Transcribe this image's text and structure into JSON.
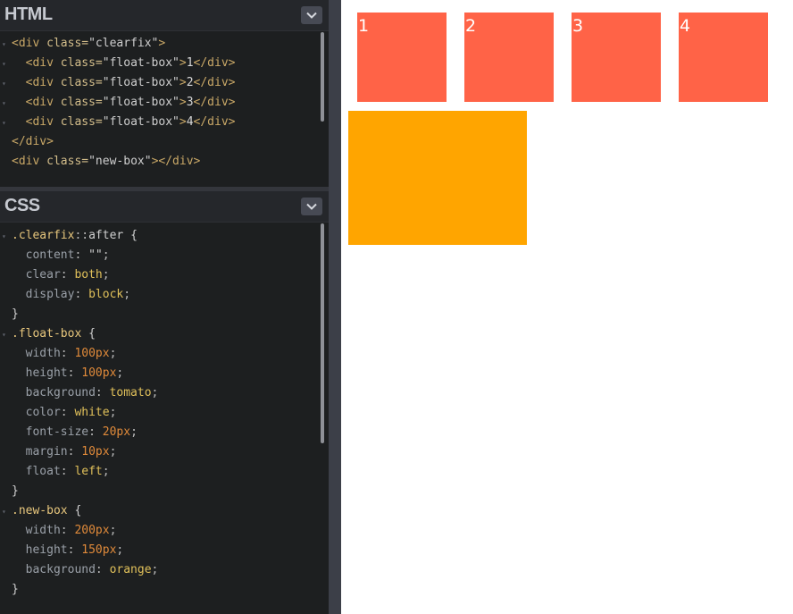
{
  "html_panel": {
    "title": "HTML",
    "lines": [
      {
        "fold": true,
        "parts": [
          [
            "tag",
            "<div "
          ],
          [
            "attr",
            "class="
          ],
          [
            "str",
            "\"clearfix\""
          ],
          [
            "tag",
            ">"
          ]
        ]
      },
      {
        "fold": true,
        "parts": [
          [
            "txt",
            "  "
          ],
          [
            "tag",
            "<div "
          ],
          [
            "attr",
            "class="
          ],
          [
            "str",
            "\"float-box\""
          ],
          [
            "tag",
            ">"
          ],
          [
            "txt",
            "1"
          ],
          [
            "tag",
            "</div>"
          ]
        ]
      },
      {
        "fold": true,
        "parts": [
          [
            "txt",
            "  "
          ],
          [
            "tag",
            "<div "
          ],
          [
            "attr",
            "class="
          ],
          [
            "str",
            "\"float-box\""
          ],
          [
            "tag",
            ">"
          ],
          [
            "txt",
            "2"
          ],
          [
            "tag",
            "</div>"
          ]
        ]
      },
      {
        "fold": true,
        "parts": [
          [
            "txt",
            "  "
          ],
          [
            "tag",
            "<div "
          ],
          [
            "attr",
            "class="
          ],
          [
            "str",
            "\"float-box\""
          ],
          [
            "tag",
            ">"
          ],
          [
            "txt",
            "3"
          ],
          [
            "tag",
            "</div>"
          ]
        ]
      },
      {
        "fold": true,
        "parts": [
          [
            "txt",
            "  "
          ],
          [
            "tag",
            "<div "
          ],
          [
            "attr",
            "class="
          ],
          [
            "str",
            "\"float-box\""
          ],
          [
            "tag",
            ">"
          ],
          [
            "txt",
            "4"
          ],
          [
            "tag",
            "</div>"
          ]
        ]
      },
      {
        "fold": false,
        "parts": [
          [
            "tag",
            "</div>"
          ]
        ]
      },
      {
        "fold": false,
        "parts": [
          [
            "tag",
            "<div "
          ],
          [
            "attr",
            "class="
          ],
          [
            "str",
            "\"new-box\""
          ],
          [
            "tag",
            "></div>"
          ]
        ]
      }
    ]
  },
  "css_panel": {
    "title": "CSS",
    "lines": [
      {
        "fold": true,
        "parts": [
          [
            "sel",
            ".clearfix"
          ],
          [
            "punct",
            "::"
          ],
          [
            "brace",
            "after {"
          ]
        ]
      },
      {
        "fold": false,
        "parts": [
          [
            "prop",
            "  content"
          ],
          [
            "punct",
            ": "
          ],
          [
            "str",
            "\"\""
          ],
          [
            "punct",
            ";"
          ]
        ]
      },
      {
        "fold": false,
        "parts": [
          [
            "prop",
            "  clear"
          ],
          [
            "punct",
            ": "
          ],
          [
            "val",
            "both"
          ],
          [
            "punct",
            ";"
          ]
        ]
      },
      {
        "fold": false,
        "parts": [
          [
            "prop",
            "  display"
          ],
          [
            "punct",
            ": "
          ],
          [
            "val",
            "block"
          ],
          [
            "punct",
            ";"
          ]
        ]
      },
      {
        "fold": false,
        "parts": [
          [
            "brace",
            "}"
          ]
        ]
      },
      {
        "fold": true,
        "parts": [
          [
            "sel",
            ".float-box"
          ],
          [
            "brace",
            " {"
          ]
        ]
      },
      {
        "fold": false,
        "parts": [
          [
            "prop",
            "  width"
          ],
          [
            "punct",
            ": "
          ],
          [
            "num",
            "100px"
          ],
          [
            "punct",
            ";"
          ]
        ]
      },
      {
        "fold": false,
        "parts": [
          [
            "prop",
            "  height"
          ],
          [
            "punct",
            ": "
          ],
          [
            "num",
            "100px"
          ],
          [
            "punct",
            ";"
          ]
        ]
      },
      {
        "fold": false,
        "parts": [
          [
            "prop",
            "  background"
          ],
          [
            "punct",
            ": "
          ],
          [
            "val",
            "tomato"
          ],
          [
            "punct",
            ";"
          ]
        ]
      },
      {
        "fold": false,
        "parts": [
          [
            "prop",
            "  color"
          ],
          [
            "punct",
            ": "
          ],
          [
            "val",
            "white"
          ],
          [
            "punct",
            ";"
          ]
        ]
      },
      {
        "fold": false,
        "parts": [
          [
            "prop",
            "  font-size"
          ],
          [
            "punct",
            ": "
          ],
          [
            "num",
            "20px"
          ],
          [
            "punct",
            ";"
          ]
        ]
      },
      {
        "fold": false,
        "parts": [
          [
            "prop",
            "  margin"
          ],
          [
            "punct",
            ": "
          ],
          [
            "num",
            "10px"
          ],
          [
            "punct",
            ";"
          ]
        ]
      },
      {
        "fold": false,
        "parts": [
          [
            "prop",
            "  float"
          ],
          [
            "punct",
            ": "
          ],
          [
            "val",
            "left"
          ],
          [
            "punct",
            ";"
          ]
        ]
      },
      {
        "fold": false,
        "parts": [
          [
            "brace",
            "}"
          ]
        ]
      },
      {
        "fold": true,
        "parts": [
          [
            "sel",
            ".new-box"
          ],
          [
            "brace",
            " {"
          ]
        ]
      },
      {
        "fold": false,
        "parts": [
          [
            "prop",
            "  width"
          ],
          [
            "punct",
            ": "
          ],
          [
            "num",
            "200px"
          ],
          [
            "punct",
            ";"
          ]
        ]
      },
      {
        "fold": false,
        "parts": [
          [
            "prop",
            "  height"
          ],
          [
            "punct",
            ": "
          ],
          [
            "num",
            "150px"
          ],
          [
            "punct",
            ";"
          ]
        ]
      },
      {
        "fold": false,
        "parts": [
          [
            "prop",
            "  background"
          ],
          [
            "punct",
            ": "
          ],
          [
            "val",
            "orange"
          ],
          [
            "punct",
            ";"
          ]
        ]
      },
      {
        "fold": false,
        "parts": [
          [
            "brace",
            "}"
          ]
        ]
      }
    ]
  },
  "preview": {
    "float_boxes": [
      "1",
      "2",
      "3",
      "4"
    ],
    "float_box_color": "#ff6347",
    "new_box_color": "#ffa500"
  },
  "icons": {
    "collapse": "chevron-down-icon",
    "fold": "fold-triangle-icon"
  }
}
